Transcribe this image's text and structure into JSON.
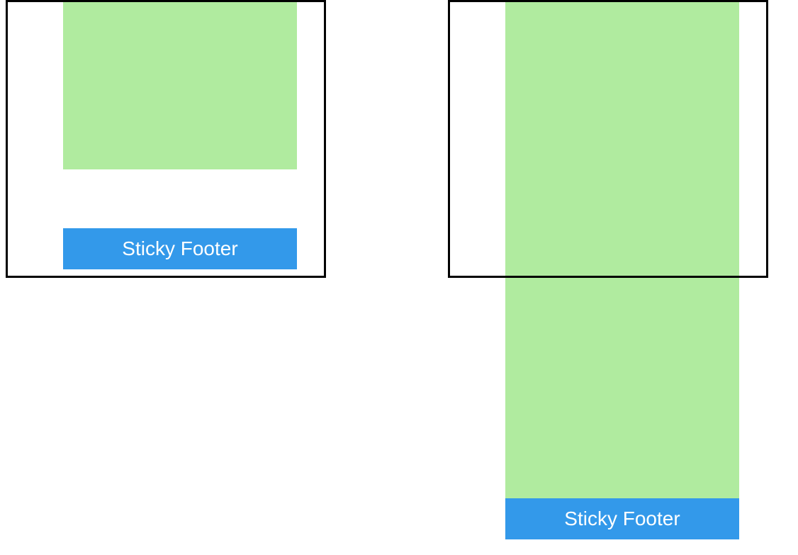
{
  "diagram": {
    "left": {
      "footer_label": "Sticky Footer"
    },
    "right": {
      "footer_label": "Sticky Footer"
    },
    "colors": {
      "content": "#b0eb9f",
      "footer": "#3399ea",
      "footer_text": "#ffffff",
      "viewport_border": "#000000"
    }
  }
}
